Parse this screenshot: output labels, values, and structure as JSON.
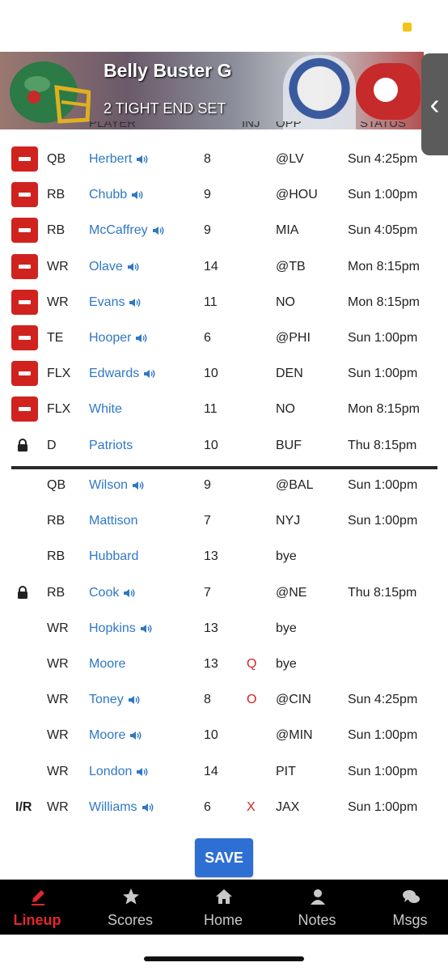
{
  "banner": {
    "title": "Belly Buster G",
    "subtitle": "2 TIGHT END SET"
  },
  "table_header_partial": [
    "PLAYER",
    "INJ",
    "OPP",
    "STATUS"
  ],
  "starters": [
    {
      "pos": "QB",
      "player": "Herbert",
      "audio": true,
      "num": "8",
      "inj": "",
      "opp": "@LV",
      "status": "Sun 4:25pm",
      "marker": "remove"
    },
    {
      "pos": "RB",
      "player": "Chubb",
      "audio": true,
      "num": "9",
      "inj": "",
      "opp": "@HOU",
      "status": "Sun 1:00pm",
      "marker": "remove"
    },
    {
      "pos": "RB",
      "player": "McCaffrey",
      "audio": true,
      "num": "9",
      "inj": "",
      "opp": "MIA",
      "status": "Sun 4:05pm",
      "marker": "remove"
    },
    {
      "pos": "WR",
      "player": "Olave",
      "audio": true,
      "num": "14",
      "inj": "",
      "opp": "@TB",
      "status": "Mon 8:15pm",
      "marker": "remove"
    },
    {
      "pos": "WR",
      "player": "Evans",
      "audio": true,
      "num": "11",
      "inj": "",
      "opp": "NO",
      "status": "Mon 8:15pm",
      "marker": "remove"
    },
    {
      "pos": "TE",
      "player": "Hooper",
      "audio": true,
      "num": "6",
      "inj": "",
      "opp": "@PHI",
      "status": "Sun 1:00pm",
      "marker": "remove"
    },
    {
      "pos": "FLX",
      "player": "Edwards",
      "audio": true,
      "num": "10",
      "inj": "",
      "opp": "DEN",
      "status": "Sun 1:00pm",
      "marker": "remove"
    },
    {
      "pos": "FLX",
      "player": "White",
      "audio": false,
      "num": "11",
      "inj": "",
      "opp": "NO",
      "status": "Mon 8:15pm",
      "marker": "remove"
    },
    {
      "pos": "D",
      "player": "Patriots",
      "audio": false,
      "num": "10",
      "inj": "",
      "opp": "BUF",
      "status": "Thu 8:15pm",
      "marker": "lock"
    }
  ],
  "bench": [
    {
      "pos": "QB",
      "player": "Wilson",
      "audio": true,
      "num": "9",
      "inj": "",
      "opp": "@BAL",
      "status": "Sun 1:00pm",
      "marker": ""
    },
    {
      "pos": "RB",
      "player": "Mattison",
      "audio": false,
      "num": "7",
      "inj": "",
      "opp": "NYJ",
      "status": "Sun 1:00pm",
      "marker": ""
    },
    {
      "pos": "RB",
      "player": "Hubbard",
      "audio": false,
      "num": "13",
      "inj": "",
      "opp": "bye",
      "status": "",
      "marker": ""
    },
    {
      "pos": "RB",
      "player": "Cook",
      "audio": true,
      "num": "7",
      "inj": "",
      "opp": "@NE",
      "status": "Thu 8:15pm",
      "marker": "lock"
    },
    {
      "pos": "WR",
      "player": "Hopkins",
      "audio": true,
      "num": "13",
      "inj": "",
      "opp": "bye",
      "status": "",
      "marker": ""
    },
    {
      "pos": "WR",
      "player": "Moore",
      "audio": false,
      "num": "13",
      "inj": "Q",
      "opp": "bye",
      "status": "",
      "marker": ""
    },
    {
      "pos": "WR",
      "player": "Toney",
      "audio": true,
      "num": "8",
      "inj": "O",
      "opp": "@CIN",
      "status": "Sun 4:25pm",
      "marker": ""
    },
    {
      "pos": "WR",
      "player": "Moore",
      "audio": true,
      "num": "10",
      "inj": "",
      "opp": "@MIN",
      "status": "Sun 1:00pm",
      "marker": ""
    },
    {
      "pos": "WR",
      "player": "London",
      "audio": true,
      "num": "14",
      "inj": "",
      "opp": "PIT",
      "status": "Sun 1:00pm",
      "marker": ""
    },
    {
      "pos": "WR",
      "player": "Williams",
      "audio": true,
      "num": "6",
      "inj": "X",
      "opp": "JAX",
      "status": "Sun 1:00pm",
      "marker": "I/R"
    }
  ],
  "save_label": "SAVE",
  "tabs": [
    {
      "label": "Lineup",
      "icon": "pencil-icon",
      "active": true
    },
    {
      "label": "Scores",
      "icon": "star-icon",
      "active": false
    },
    {
      "label": "Home",
      "icon": "home-icon",
      "active": false
    },
    {
      "label": "Notes",
      "icon": "user-icon",
      "active": false
    },
    {
      "label": "Msgs",
      "icon": "chat-bubbles-icon",
      "active": false
    }
  ],
  "colors": {
    "remove_red": "#d0231f",
    "link_blue": "#2f78c4",
    "save_blue": "#2e6fd3",
    "active_tab_red": "#e0282c",
    "status_yellow": "#f2c418"
  }
}
